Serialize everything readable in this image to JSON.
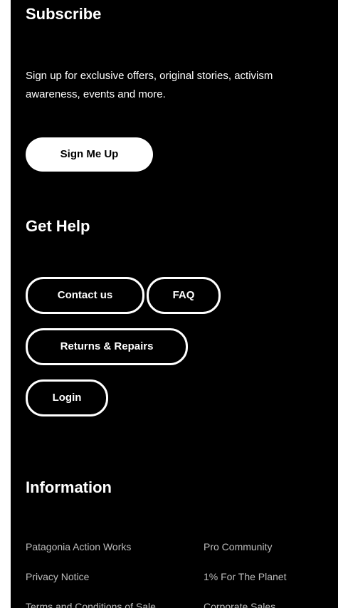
{
  "subscribe": {
    "title": "Subscribe",
    "description": "Sign up for exclusive offers, original stories, activism awareness, events and more.",
    "button_label": "Sign Me Up"
  },
  "help": {
    "title": "Get Help",
    "contact_label": "Contact us",
    "faq_label": "FAQ",
    "returns_label": "Returns & Repairs",
    "login_label": "Login"
  },
  "information": {
    "title": "Information",
    "links": [
      "Patagonia Action Works",
      "Pro Community",
      "Privacy Notice",
      "1% For The Planet",
      "Terms and Conditions of Sale",
      "Corporate Sales"
    ]
  },
  "colors": {
    "background": "#000000",
    "text": "#ffffff",
    "link_text": "#bdbdbd",
    "primary_button_bg": "#ffffff"
  }
}
